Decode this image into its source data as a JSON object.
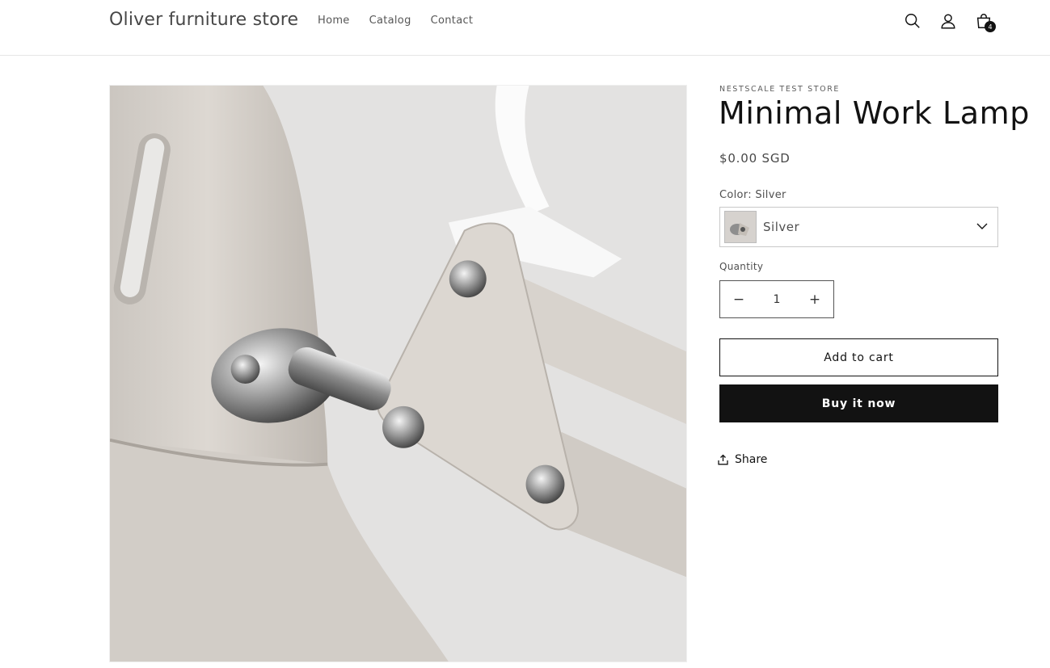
{
  "header": {
    "store_name": "Oliver furniture store",
    "nav": [
      {
        "label": "Home"
      },
      {
        "label": "Catalog"
      },
      {
        "label": "Contact"
      }
    ],
    "icons": [
      "search-icon",
      "account-icon",
      "cart-icon"
    ],
    "cart_count": "4"
  },
  "product": {
    "vendor": "NESTSCALE TEST STORE",
    "title": "Minimal Work Lamp",
    "price": "$0.00 SGD",
    "variant_label": "Color: Silver",
    "variant_selected": "Silver",
    "quantity_label": "Quantity",
    "quantity": "1",
    "quantity_minus": "−",
    "quantity_plus": "+",
    "add_to_cart": "Add to cart",
    "buy_now": "Buy it now",
    "share": "Share"
  },
  "colors": {
    "primary": "#121212",
    "background": "#ffffff",
    "border": "#c9c9c9"
  }
}
